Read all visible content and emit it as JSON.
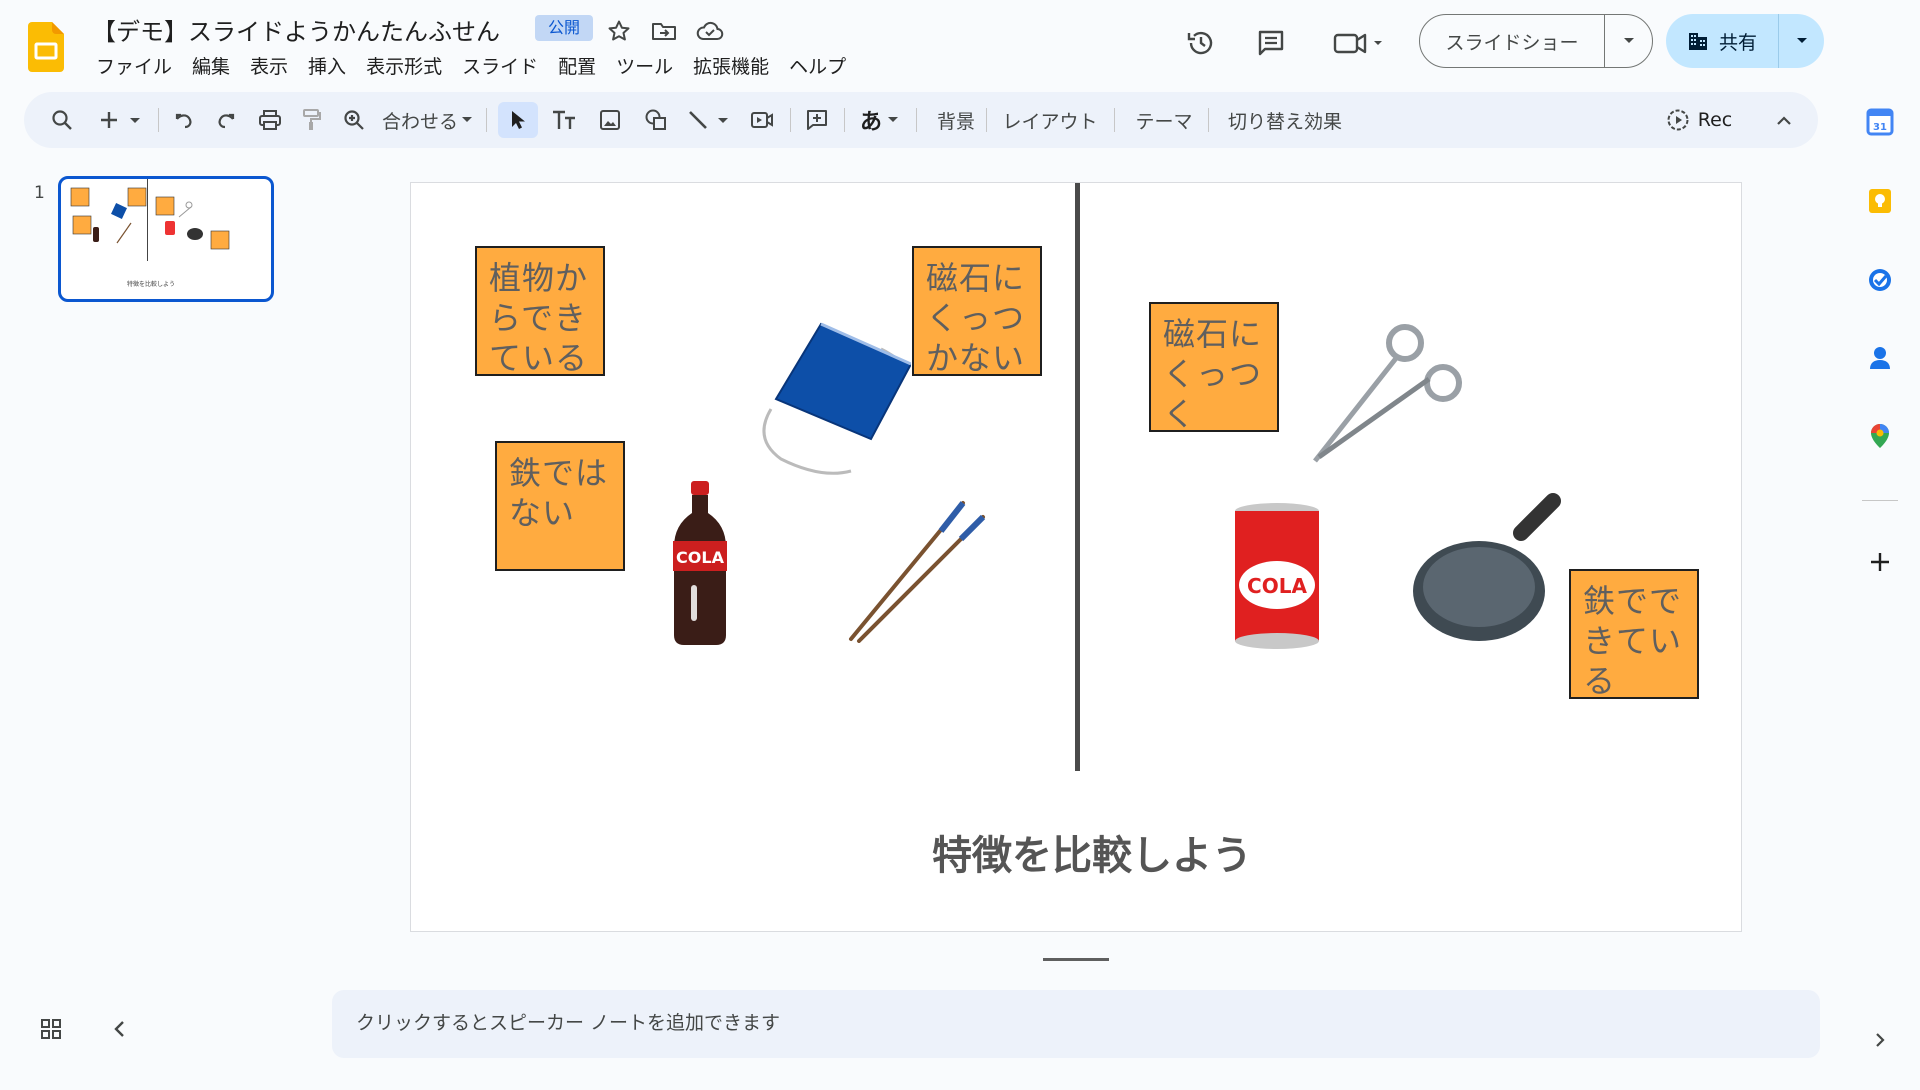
{
  "app": {
    "title": "【デモ】スライドようかんたんふせん",
    "badge": "公開"
  },
  "menu": [
    "ファイル",
    "編集",
    "表示",
    "挿入",
    "表示形式",
    "スライド",
    "配置",
    "ツール",
    "拡張機能",
    "ヘルプ"
  ],
  "header": {
    "slideshow_label": "スライドショー",
    "share_label": "共有"
  },
  "toolbar": {
    "zoom_label": "合わせる",
    "background_label": "背景",
    "layout_label": "レイアウト",
    "theme_label": "テーマ",
    "transition_label": "切り替え効果",
    "rec_label": "Rec",
    "input_tool_label": "あ"
  },
  "filmstrip": {
    "slide_number": "1",
    "thumb_caption": "特徴を比較しよう"
  },
  "slide": {
    "title": "特徴を比較しよう",
    "notes_left": [
      "植物からできている",
      "磁石にくっつかない",
      "鉄ではない"
    ],
    "notes_right": [
      "磁石にくっつく",
      "鉄でできている"
    ],
    "bottle_label": "COLA",
    "can_label": "COLA"
  },
  "speaker_notes": {
    "placeholder": "クリックするとスピーカー ノートを追加できます"
  },
  "colors": {
    "note": "#ffab40",
    "accent": "#0b57d0",
    "share_bg": "#c2e7ff"
  }
}
